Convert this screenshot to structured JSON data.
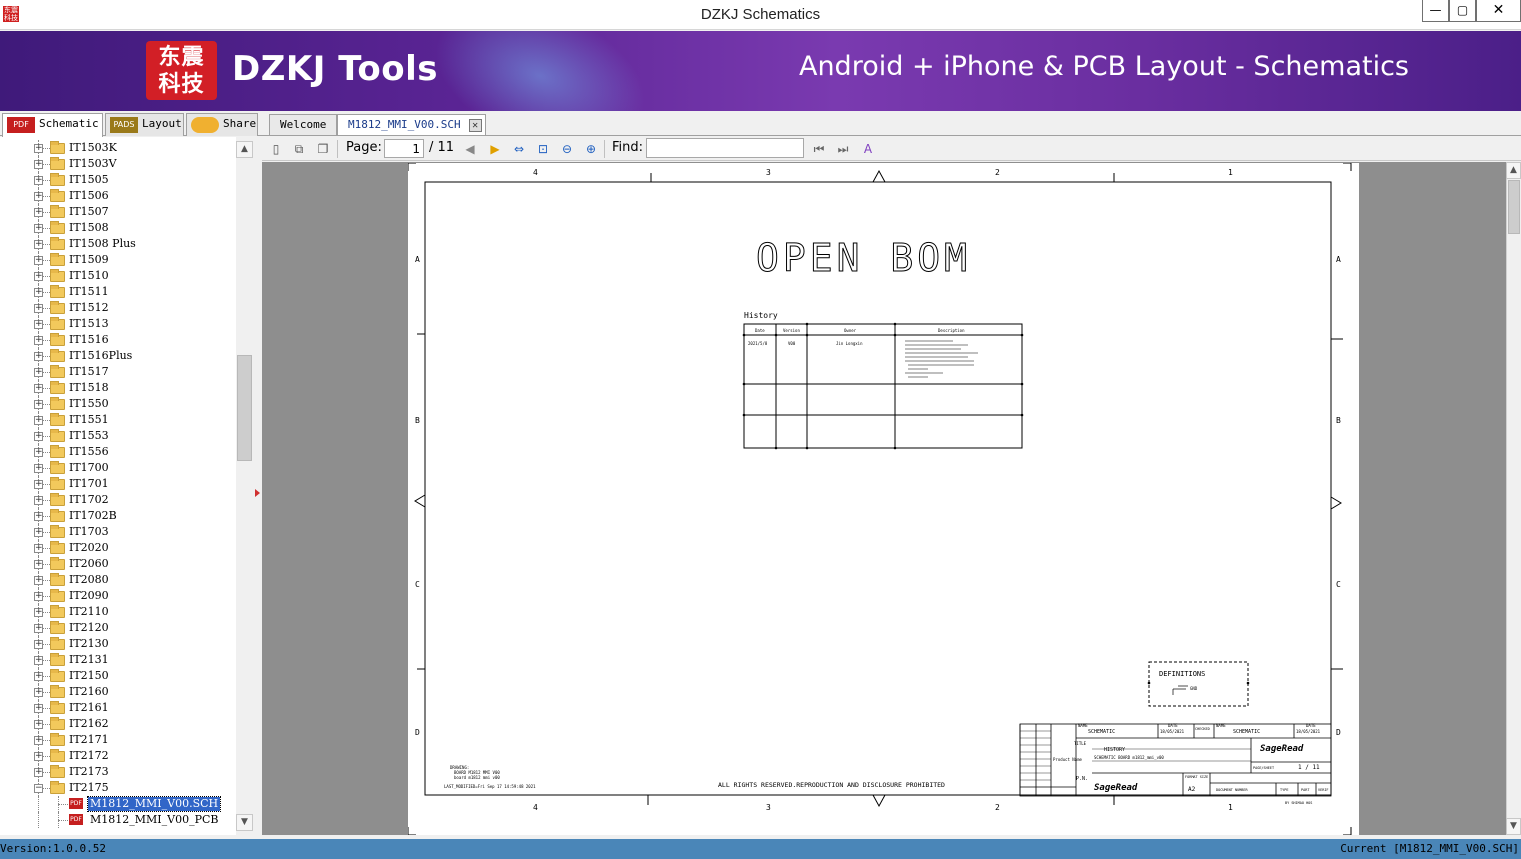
{
  "window": {
    "title": "DZKJ Schematics",
    "app_icon_text": "东震科技",
    "minimize_label": "—",
    "maximize_label": "▢",
    "close_label": "✕"
  },
  "banner": {
    "logo_text_line1": "东震",
    "logo_text_line2": "科技",
    "brand": "DZKJ Tools",
    "tagline": "Android + iPhone & PCB Layout - Schematics"
  },
  "main_tabs": [
    {
      "label": "Schematic",
      "icon": "pdf-icon",
      "icon_text": "PDF",
      "active": true
    },
    {
      "label": "Layout",
      "icon": "pads-icon",
      "icon_text": "PADS",
      "active": false
    },
    {
      "label": "Share",
      "icon": "cloud-share-icon",
      "icon_text": "",
      "active": false
    }
  ],
  "doc_tabs": [
    {
      "label": "Welcome",
      "active": false
    },
    {
      "label": "M1812_MMI_V00.SCH",
      "active": true
    }
  ],
  "tree": {
    "folders": [
      "IT1503K",
      "IT1503V",
      "IT1505",
      "IT1506",
      "IT1507",
      "IT1508",
      "IT1508 Plus",
      "IT1509",
      "IT1510",
      "IT1511",
      "IT1512",
      "IT1513",
      "IT1516",
      "IT1516Plus",
      "IT1517",
      "IT1518",
      "IT1550",
      "IT1551",
      "IT1553",
      "IT1556",
      "IT1700",
      "IT1701",
      "IT1702",
      "IT1702B",
      "IT1703",
      "IT2020",
      "IT2060",
      "IT2080",
      "IT2090",
      "IT2110",
      "IT2120",
      "IT2130",
      "IT2131",
      "IT2150",
      "IT2160",
      "IT2161",
      "IT2162",
      "IT2171",
      "IT2172",
      "IT2173",
      "IT2175"
    ],
    "expanded_folder": "IT2175",
    "children": [
      {
        "label": "M1812_MMI_V00.SCH",
        "selected": true
      },
      {
        "label": "M1812_MMI_V00_PCB",
        "selected": false
      }
    ]
  },
  "toolbar": {
    "page_label": "Page:",
    "page_value": "1",
    "page_total": "/ 11",
    "find_label": "Find:",
    "find_value": ""
  },
  "schematic": {
    "title": "OPEN BOM",
    "history_label": "History",
    "col_labels": [
      "4",
      "3",
      "2",
      "1"
    ],
    "row_labels": [
      "A",
      "B",
      "C",
      "D"
    ],
    "history_headers": [
      "Date",
      "Version",
      "Owner",
      "Description"
    ],
    "history_row": {
      "date": "2021/5/8",
      "version": "V00",
      "owner": "Jin Longxin"
    },
    "definitions_label": "DEFINITIONS",
    "definitions_item": "GND",
    "rights_text": "ALL RIGHTS RESERVED.REPRODUCTION AND DISCLOSURE PROHIBITED",
    "drawing_label": "DRAWING:",
    "drawing_lines": [
      "BOARD M1812 MMI V00",
      "board m1812 mmi v00"
    ],
    "last_modified": "LAST_MODIFIED=Fri Sep 17 14:59:48 2021",
    "title_block": {
      "name_label": "NAME",
      "name_value": "SCHEMATIC",
      "date_label": "DATE",
      "date_value": "18/05/2021",
      "checked_label": "CHECKED",
      "checked_name": "SCHEMATIC",
      "checked_date": "18/05/2021",
      "title_label": "TITLE",
      "title_value": "HISTORY",
      "product_label": "Product Name",
      "product_value": "SCHEMATIC BOARD m1812_mmi_v00",
      "page_sheet_label": "PAGE/SHEET",
      "page_sheet_value": "1 / 11",
      "format_label": "FORMAT SIZE",
      "format_value": "A2",
      "document_number": "DOCUMENT NUMBER",
      "type": "TYPE",
      "part": "PART",
      "verif": "VERIF",
      "pn_label": "P.N.",
      "logo": "SageRead",
      "drawn_by": "BY SHIMAO HOS"
    }
  },
  "status": {
    "version": "Version:1.0.0.52",
    "current": "Current [M1812_MMI_V00.SCH]"
  },
  "colors": {
    "banner_start": "#3f1a7a",
    "banner_end": "#4b1f88",
    "status_bar": "#4a86b8",
    "selection": "#3166c8",
    "logo_red": "#d21f26"
  }
}
